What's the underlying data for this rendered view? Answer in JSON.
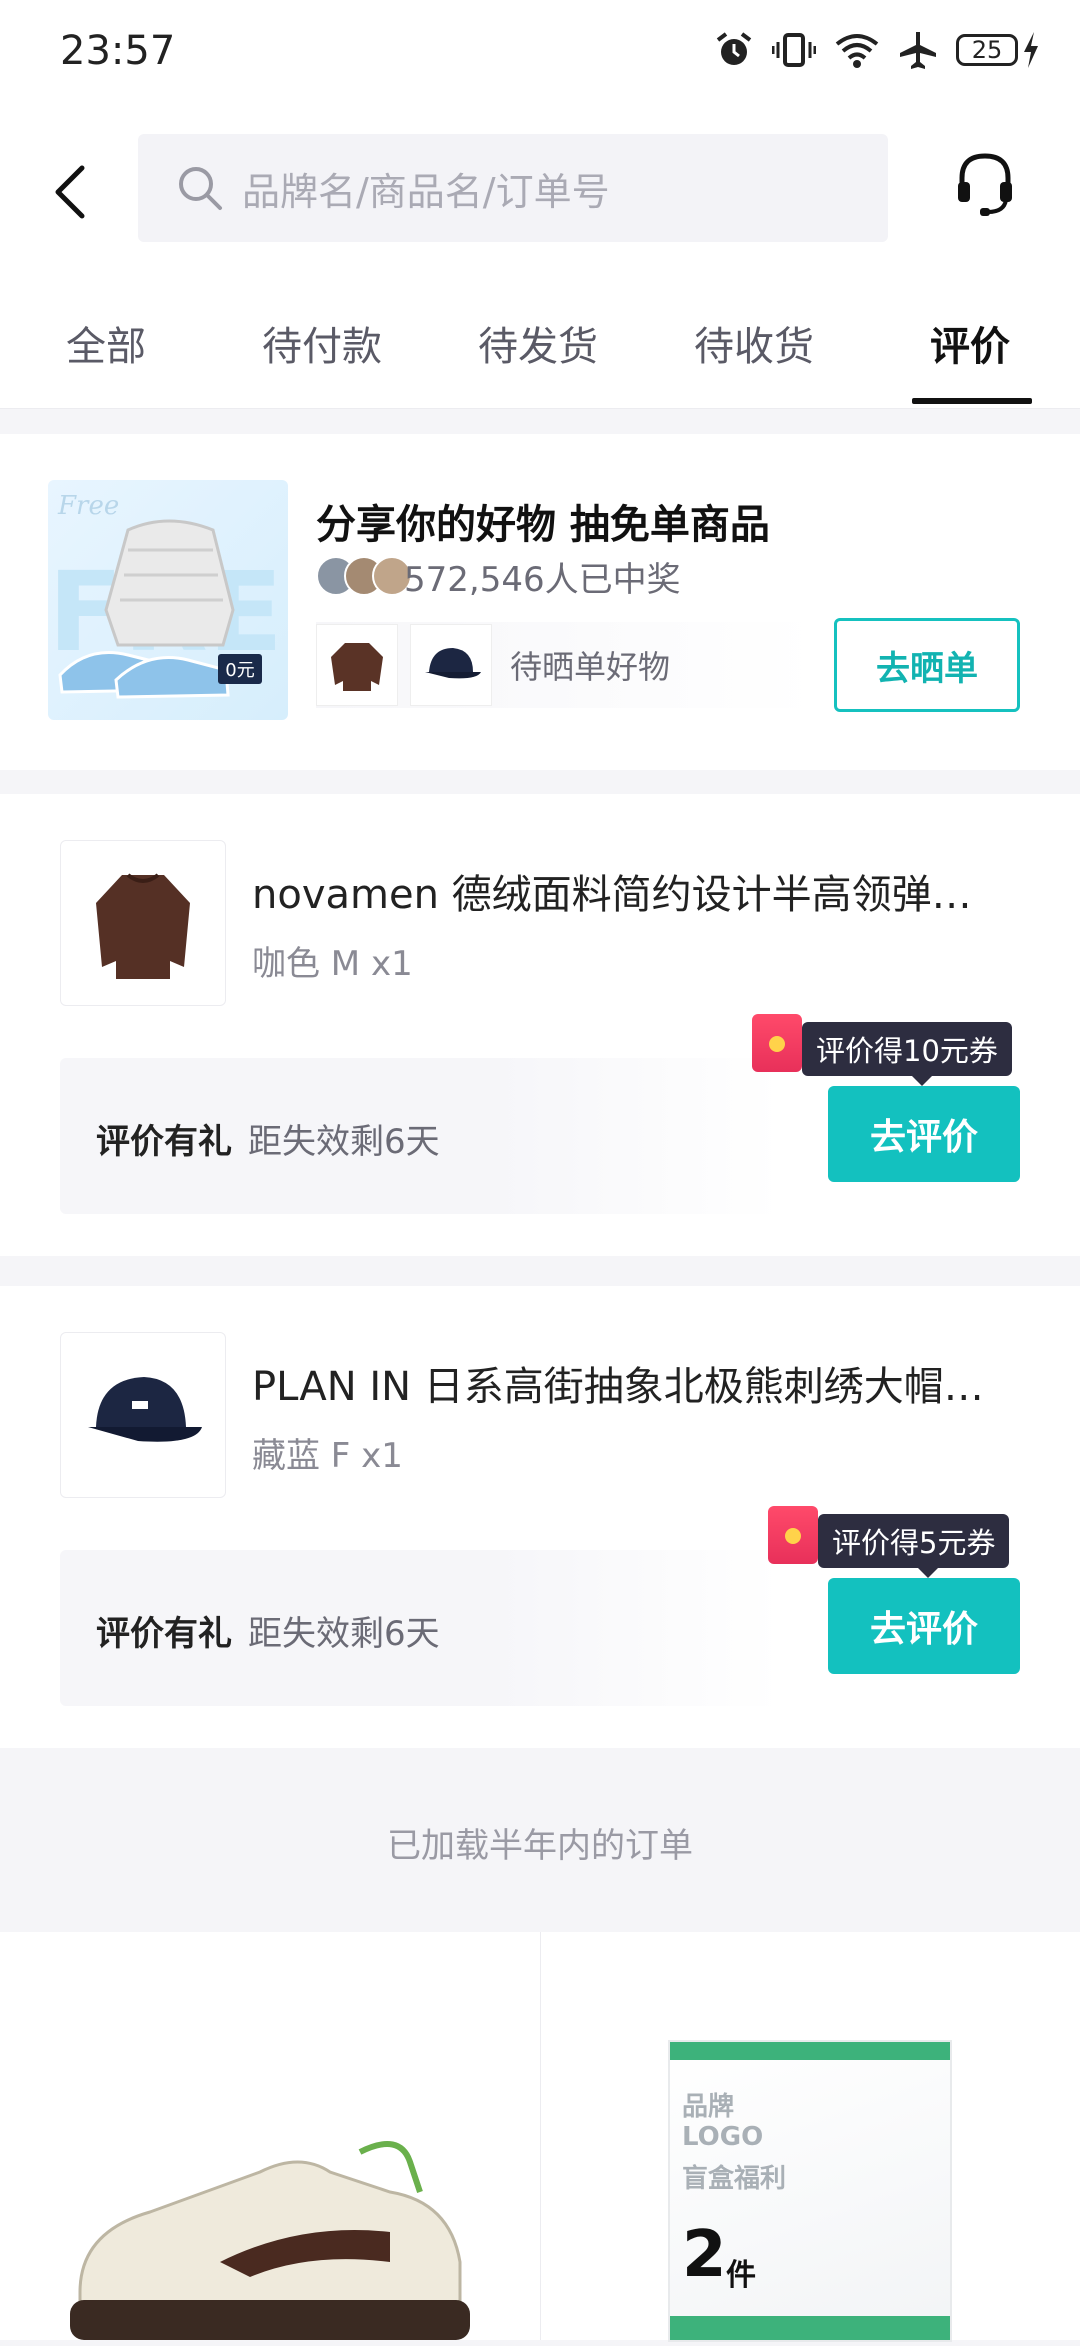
{
  "status_bar": {
    "time": "23:57",
    "battery": "25"
  },
  "search": {
    "placeholder": "品牌名/商品名/订单号"
  },
  "tabs": [
    {
      "label": "全部"
    },
    {
      "label": "待付款"
    },
    {
      "label": "待发货"
    },
    {
      "label": "待收货"
    },
    {
      "label": "评价",
      "active": true
    }
  ],
  "share": {
    "title": "分享你的好物 抽免单商品",
    "winners": "572,546人已中奖",
    "pending": "待晒单好物",
    "button": "去晒单",
    "badge": "0元"
  },
  "orders": [
    {
      "title": "novamen 德绒面料简约设计半高领弹…",
      "spec": "咖色 M x1",
      "reward_label": "评价有礼",
      "reward_time": "距失效剩6天",
      "coupon": "评价得10元券",
      "button": "去评价"
    },
    {
      "title": "PLAN IN 日系高街抽象北极熊刺绣大帽…",
      "spec": "藏蓝 F x1",
      "reward_label": "评价有礼",
      "reward_time": "距失效剩6天",
      "coupon": "评价得5元券",
      "button": "去评价"
    }
  ],
  "loaded_notice": "已加载半年内的订单",
  "recommend": {
    "box_lines": [
      "品牌",
      "LOGO",
      "盲盒福利"
    ],
    "box_count": "2",
    "box_unit": "件"
  },
  "colors": {
    "accent": "#13c1bf",
    "tag_bg": "#2d2d40",
    "red": "#e8305a"
  }
}
